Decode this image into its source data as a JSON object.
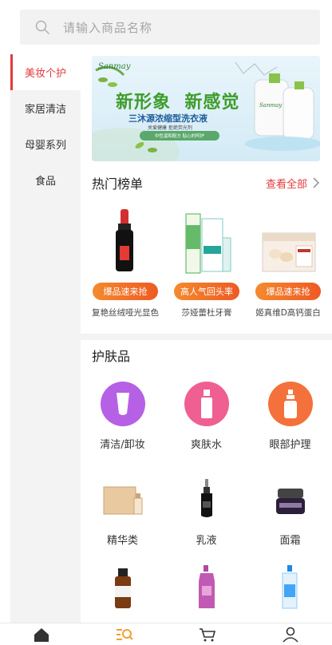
{
  "search": {
    "placeholder": "请输入商品名称"
  },
  "sidebar": {
    "items": [
      {
        "label": "美妆个护",
        "active": true
      },
      {
        "label": "家居清洁"
      },
      {
        "label": "母婴系列"
      },
      {
        "label": "食品"
      }
    ]
  },
  "banner": {
    "brand": "Sanmay",
    "headline": "新形象  新感觉",
    "product": "三沐源浓缩型洗衣液",
    "sub": "关爱健康  拒绝荧光剂",
    "badge": "中性温和配方 贴心的呵护",
    "bottle_brand": "Sanmay"
  },
  "hot": {
    "title": "热门榜单",
    "see_all": "查看全部"
  },
  "products": [
    {
      "tag": "爆品速来抢",
      "name": "复艳丝绒哑光显色"
    },
    {
      "tag": "高人气回头率",
      "name": "莎娅蕾杜牙膏"
    },
    {
      "tag": "爆品速来抢",
      "name": "姬真维D高钙蛋白"
    }
  ],
  "category": {
    "title": "护肤品",
    "items": [
      {
        "label": "清洁/卸妆"
      },
      {
        "label": "爽肤水"
      },
      {
        "label": "眼部护理"
      },
      {
        "label": "精华类"
      },
      {
        "label": "乳液"
      },
      {
        "label": "面霜"
      },
      {
        "label": "..."
      },
      {
        "label": "..."
      },
      {
        "label": "..."
      }
    ]
  },
  "colors": {
    "accent": "#e4393c",
    "tab_active": "#f0a030"
  }
}
